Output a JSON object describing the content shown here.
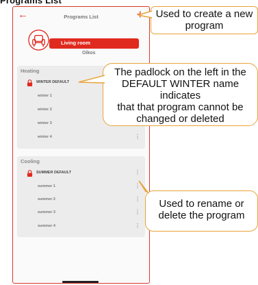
{
  "page_heading": "Programs List",
  "app": {
    "title": "Programs List",
    "back_icon": "arrow-left-icon",
    "add_icon": "plus-icon",
    "accent_color": "#e02a1f"
  },
  "room": {
    "icon": "armchair-icon",
    "name": "Living room",
    "subtitle": "Oikos"
  },
  "heating": {
    "title": "Heating",
    "default_program": "WINTER DEFAULT",
    "programs": [
      "winter 1",
      "winter 2",
      "winter 3",
      "winter 4"
    ]
  },
  "cooling": {
    "title": "Cooling",
    "default_program": "SUMMER DEFAULT",
    "programs": [
      "summer 1",
      "summer 2",
      "summer 3",
      "summer 4"
    ]
  },
  "callouts": {
    "add_program": {
      "line1": "Used to create a new",
      "line2": "program"
    },
    "padlock": {
      "line1": "The padlock on the left in the",
      "line2": "DEFAULT WINTER name indicates",
      "line3": "that that program cannot be",
      "line4": "changed or deleted"
    },
    "kebab": {
      "line1": "Used to rename or",
      "line2": "delete the program"
    },
    "border_color": "#e8a33a"
  }
}
